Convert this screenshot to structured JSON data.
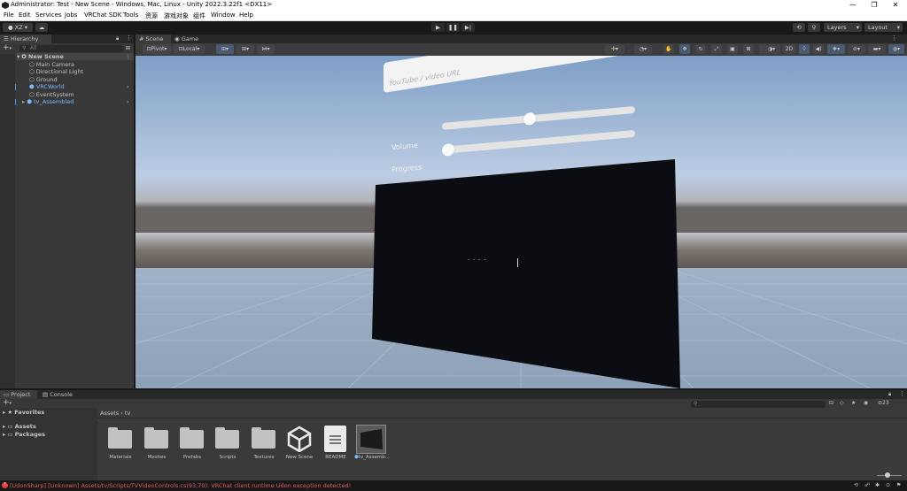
{
  "window": {
    "title": "Administrator: Test - New Scene - Windows, Mac, Linux - Unity 2022.3.22f1 <DX11>",
    "minimize": "—",
    "maximize": "❐",
    "close": "✕"
  },
  "menu": [
    "File",
    "Edit",
    "Services",
    "Jobs",
    "VRChat SDK",
    "Tools",
    "资源",
    "游戏对象",
    "组件",
    "Window",
    "Help"
  ],
  "toolbar": {
    "account": "XZ",
    "layers": "Layers",
    "layout": "Layout"
  },
  "hierarchy": {
    "tab": "Hierarchy",
    "search_placeholder": "All",
    "items": [
      {
        "label": "New Scene"
      },
      {
        "label": "Main Camera"
      },
      {
        "label": "Directional Light"
      },
      {
        "label": "Ground"
      },
      {
        "label": "VRCWorld"
      },
      {
        "label": "EventSystem"
      },
      {
        "label": "tv_Assembled"
      }
    ]
  },
  "scene": {
    "tabs": [
      "Scene",
      "Game"
    ],
    "pivot": "Pivot",
    "local": "Local",
    "mode_2d": "2D",
    "ui": {
      "url_placeholder": "YouTube / video URL",
      "volume_label": "Volume",
      "progress_label": "Progress",
      "volume_value": 0.45,
      "progress_value": 0.0,
      "screen_text": "- - - -"
    }
  },
  "project": {
    "tabs": [
      "Project",
      "Console"
    ],
    "favorites": "Favorites",
    "tree": [
      "Assets",
      "Packages"
    ],
    "breadcrumb": [
      "Assets",
      "tv"
    ],
    "hidden_count": "23",
    "assets": [
      {
        "label": "Materials",
        "kind": "folder"
      },
      {
        "label": "Meshes",
        "kind": "folder"
      },
      {
        "label": "Prefabs",
        "kind": "folder"
      },
      {
        "label": "Scripts",
        "kind": "folder"
      },
      {
        "label": "Textures",
        "kind": "folder"
      },
      {
        "label": "New Scene",
        "kind": "unity"
      },
      {
        "label": "README",
        "kind": "doc"
      },
      {
        "label": "tv_Assemb...",
        "kind": "model"
      }
    ]
  },
  "status": {
    "message": "[UdonSharp] [Unknown] Assets/tv/Scripts/TVVideoControls.cs(93,70): VRChat client runtime Udon exception detected!"
  }
}
